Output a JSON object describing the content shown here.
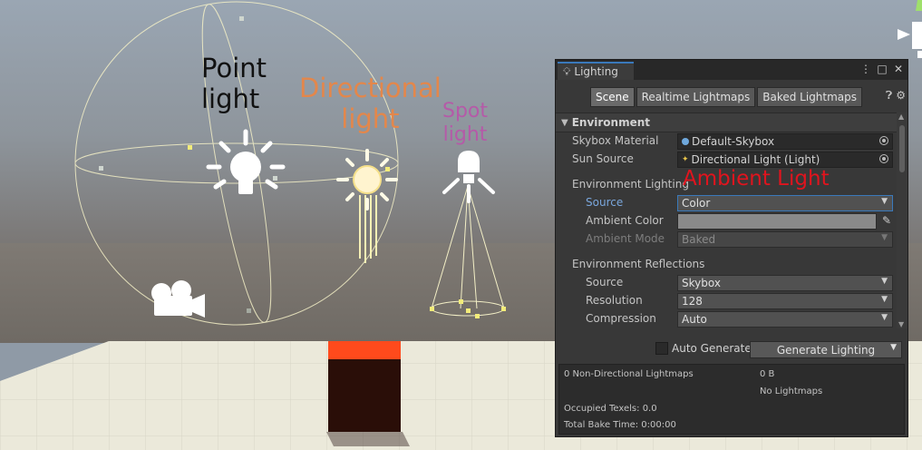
{
  "annotations": {
    "point": [
      "Point",
      "light"
    ],
    "directional": [
      "Directional",
      "light"
    ],
    "spot": [
      "Spot",
      "light"
    ],
    "ambient": "Ambient Light"
  },
  "lighting_window": {
    "title": "Lighting",
    "tabs": [
      "Scene",
      "Realtime Lightmaps",
      "Baked Lightmaps"
    ],
    "active_tab": "Scene",
    "section": "Environment",
    "skybox_material": {
      "label": "Skybox Material",
      "value": "Default-Skybox"
    },
    "sun_source": {
      "label": "Sun Source",
      "value": "Directional Light (Light)"
    },
    "environment_lighting": {
      "label": "Environment Lighting",
      "source": {
        "label": "Source",
        "value": "Color"
      },
      "ambient_color": {
        "label": "Ambient Color",
        "value": "#8a8a8a"
      },
      "ambient_mode": {
        "label": "Ambient Mode",
        "value": "Baked"
      }
    },
    "environment_reflections": {
      "label": "Environment Reflections",
      "source": {
        "label": "Source",
        "value": "Skybox"
      },
      "resolution": {
        "label": "Resolution",
        "value": "128"
      },
      "compression": {
        "label": "Compression",
        "value": "Auto"
      }
    },
    "auto_generate": {
      "label": "Auto Generate",
      "checked": false
    },
    "generate_button": "Generate Lighting",
    "stats": {
      "non_directional": "0 Non-Directional Lightmaps",
      "size": "0 B",
      "no_lightmaps": "No Lightmaps",
      "occupied_texels": "Occupied Texels: 0.0",
      "total_bake_time": "Total Bake Time: 0:00:00"
    }
  },
  "colors": {
    "sky": "#8f9aa6",
    "ground": "#e8e6d6",
    "cube_top": "#ff4a1c",
    "cube_side": "#2a0e08",
    "gizmo": "#f0e9a0",
    "accent": "#3a79bb"
  }
}
